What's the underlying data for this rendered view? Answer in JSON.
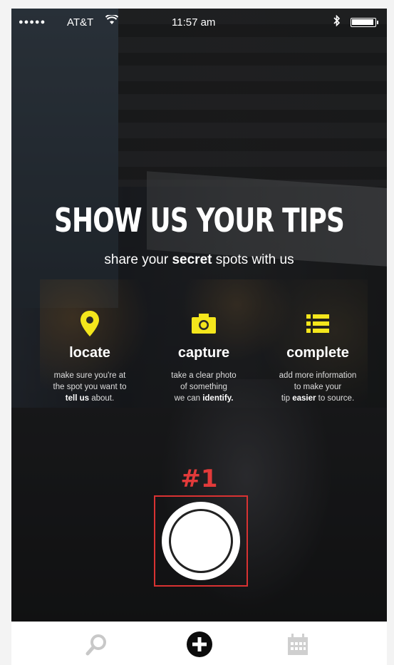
{
  "status_bar": {
    "signal": "●●●●●",
    "carrier": "AT&T",
    "wifi_icon": "wifi-icon",
    "time": "11:57 am",
    "bluetooth_icon": "bluetooth-icon",
    "battery_level": 1.0
  },
  "intro": {
    "headline": "SHOW US YOUR TIPS",
    "subhead_pre": "share your ",
    "subhead_bold": "secret",
    "subhead_post": " spots with us"
  },
  "features": [
    {
      "icon": "location-pin-icon",
      "title": "locate",
      "desc_line1": "make sure you're at",
      "desc_line2": "the spot you want to",
      "desc_bold": "tell us",
      "desc_line3_rest": " about."
    },
    {
      "icon": "camera-icon",
      "title": "capture",
      "desc_line1": "take a clear photo",
      "desc_line2": "of something",
      "desc_line3_pre": "we can ",
      "desc_bold": "identify."
    },
    {
      "icon": "list-icon",
      "title": "complete",
      "desc_line1": "add more information",
      "desc_line2": "to make your",
      "desc_line3_pre": "tip ",
      "desc_bold": "easier",
      "desc_line3_rest": " to source."
    }
  ],
  "step_label": "#1",
  "colors": {
    "accent_yellow": "#f4e61c",
    "highlight_red": "#d93232",
    "step_red": "#e23a3a"
  },
  "tabbar": {
    "items": [
      "search-icon",
      "add-circle-icon",
      "calendar-icon"
    ]
  }
}
